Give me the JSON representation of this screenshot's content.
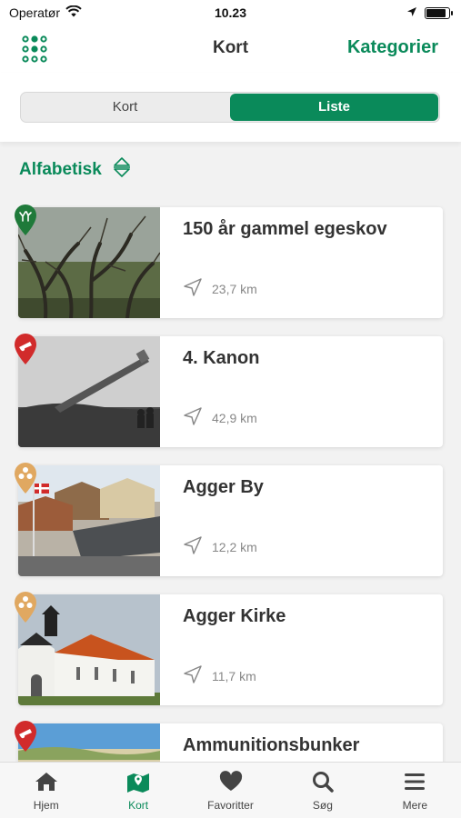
{
  "status_bar": {
    "carrier": "Operatør",
    "time": "10.23",
    "battery_level": 0.9
  },
  "nav": {
    "title": "Kort",
    "right_button": "Kategorier"
  },
  "segment": {
    "options": [
      "Kort",
      "Liste"
    ],
    "selected": "Liste"
  },
  "sort": {
    "label": "Alfabetisk"
  },
  "items": [
    {
      "title": "150 år gammel egeskov",
      "distance": "23,7 km",
      "pin_color": "#1f7a3a",
      "category_icon": "tree-icon"
    },
    {
      "title": "4. Kanon",
      "distance": "42,9 km",
      "pin_color": "#d12b2b",
      "category_icon": "cannon-icon"
    },
    {
      "title": "Agger By",
      "distance": "12,2 km",
      "pin_color": "#e0a861",
      "category_icon": "culture-icon"
    },
    {
      "title": "Agger Kirke",
      "distance": "11,7 km",
      "pin_color": "#e0a861",
      "category_icon": "culture-icon"
    },
    {
      "title": "Ammunitionsbunker",
      "distance": "",
      "pin_color": "#d12b2b",
      "category_icon": "cannon-icon"
    }
  ],
  "tabs": [
    {
      "label": "Hjem",
      "icon": "home-icon"
    },
    {
      "label": "Kort",
      "icon": "map-icon",
      "active": true
    },
    {
      "label": "Favoritter",
      "icon": "heart-icon"
    },
    {
      "label": "Søg",
      "icon": "search-icon"
    },
    {
      "label": "Mere",
      "icon": "menu-icon"
    }
  ],
  "colors": {
    "accent": "#0a8a5a",
    "danger": "#d12b2b",
    "culture": "#e0a861",
    "nature": "#1f7a3a"
  }
}
